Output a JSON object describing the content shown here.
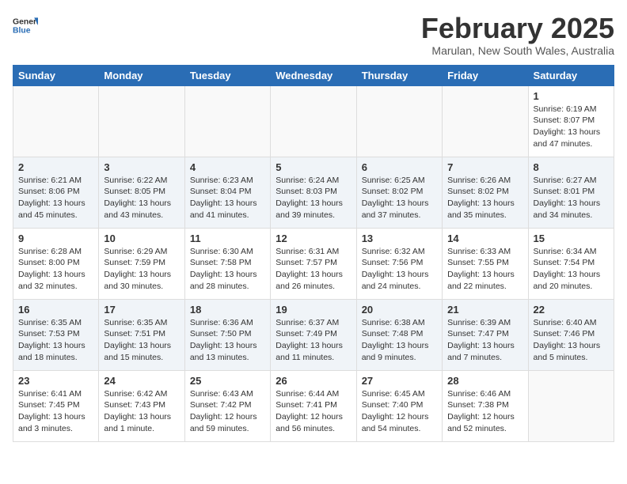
{
  "header": {
    "logo_general": "General",
    "logo_blue": "Blue",
    "month_year": "February 2025",
    "location": "Marulan, New South Wales, Australia"
  },
  "days_of_week": [
    "Sunday",
    "Monday",
    "Tuesday",
    "Wednesday",
    "Thursday",
    "Friday",
    "Saturday"
  ],
  "weeks": [
    [
      {
        "day": "",
        "info": ""
      },
      {
        "day": "",
        "info": ""
      },
      {
        "day": "",
        "info": ""
      },
      {
        "day": "",
        "info": ""
      },
      {
        "day": "",
        "info": ""
      },
      {
        "day": "",
        "info": ""
      },
      {
        "day": "1",
        "info": "Sunrise: 6:19 AM\nSunset: 8:07 PM\nDaylight: 13 hours\nand 47 minutes."
      }
    ],
    [
      {
        "day": "2",
        "info": "Sunrise: 6:21 AM\nSunset: 8:06 PM\nDaylight: 13 hours\nand 45 minutes."
      },
      {
        "day": "3",
        "info": "Sunrise: 6:22 AM\nSunset: 8:05 PM\nDaylight: 13 hours\nand 43 minutes."
      },
      {
        "day": "4",
        "info": "Sunrise: 6:23 AM\nSunset: 8:04 PM\nDaylight: 13 hours\nand 41 minutes."
      },
      {
        "day": "5",
        "info": "Sunrise: 6:24 AM\nSunset: 8:03 PM\nDaylight: 13 hours\nand 39 minutes."
      },
      {
        "day": "6",
        "info": "Sunrise: 6:25 AM\nSunset: 8:02 PM\nDaylight: 13 hours\nand 37 minutes."
      },
      {
        "day": "7",
        "info": "Sunrise: 6:26 AM\nSunset: 8:02 PM\nDaylight: 13 hours\nand 35 minutes."
      },
      {
        "day": "8",
        "info": "Sunrise: 6:27 AM\nSunset: 8:01 PM\nDaylight: 13 hours\nand 34 minutes."
      }
    ],
    [
      {
        "day": "9",
        "info": "Sunrise: 6:28 AM\nSunset: 8:00 PM\nDaylight: 13 hours\nand 32 minutes."
      },
      {
        "day": "10",
        "info": "Sunrise: 6:29 AM\nSunset: 7:59 PM\nDaylight: 13 hours\nand 30 minutes."
      },
      {
        "day": "11",
        "info": "Sunrise: 6:30 AM\nSunset: 7:58 PM\nDaylight: 13 hours\nand 28 minutes."
      },
      {
        "day": "12",
        "info": "Sunrise: 6:31 AM\nSunset: 7:57 PM\nDaylight: 13 hours\nand 26 minutes."
      },
      {
        "day": "13",
        "info": "Sunrise: 6:32 AM\nSunset: 7:56 PM\nDaylight: 13 hours\nand 24 minutes."
      },
      {
        "day": "14",
        "info": "Sunrise: 6:33 AM\nSunset: 7:55 PM\nDaylight: 13 hours\nand 22 minutes."
      },
      {
        "day": "15",
        "info": "Sunrise: 6:34 AM\nSunset: 7:54 PM\nDaylight: 13 hours\nand 20 minutes."
      }
    ],
    [
      {
        "day": "16",
        "info": "Sunrise: 6:35 AM\nSunset: 7:53 PM\nDaylight: 13 hours\nand 18 minutes."
      },
      {
        "day": "17",
        "info": "Sunrise: 6:35 AM\nSunset: 7:51 PM\nDaylight: 13 hours\nand 15 minutes."
      },
      {
        "day": "18",
        "info": "Sunrise: 6:36 AM\nSunset: 7:50 PM\nDaylight: 13 hours\nand 13 minutes."
      },
      {
        "day": "19",
        "info": "Sunrise: 6:37 AM\nSunset: 7:49 PM\nDaylight: 13 hours\nand 11 minutes."
      },
      {
        "day": "20",
        "info": "Sunrise: 6:38 AM\nSunset: 7:48 PM\nDaylight: 13 hours\nand 9 minutes."
      },
      {
        "day": "21",
        "info": "Sunrise: 6:39 AM\nSunset: 7:47 PM\nDaylight: 13 hours\nand 7 minutes."
      },
      {
        "day": "22",
        "info": "Sunrise: 6:40 AM\nSunset: 7:46 PM\nDaylight: 13 hours\nand 5 minutes."
      }
    ],
    [
      {
        "day": "23",
        "info": "Sunrise: 6:41 AM\nSunset: 7:45 PM\nDaylight: 13 hours\nand 3 minutes."
      },
      {
        "day": "24",
        "info": "Sunrise: 6:42 AM\nSunset: 7:43 PM\nDaylight: 13 hours\nand 1 minute."
      },
      {
        "day": "25",
        "info": "Sunrise: 6:43 AM\nSunset: 7:42 PM\nDaylight: 12 hours\nand 59 minutes."
      },
      {
        "day": "26",
        "info": "Sunrise: 6:44 AM\nSunset: 7:41 PM\nDaylight: 12 hours\nand 56 minutes."
      },
      {
        "day": "27",
        "info": "Sunrise: 6:45 AM\nSunset: 7:40 PM\nDaylight: 12 hours\nand 54 minutes."
      },
      {
        "day": "28",
        "info": "Sunrise: 6:46 AM\nSunset: 7:38 PM\nDaylight: 12 hours\nand 52 minutes."
      },
      {
        "day": "",
        "info": ""
      }
    ]
  ]
}
